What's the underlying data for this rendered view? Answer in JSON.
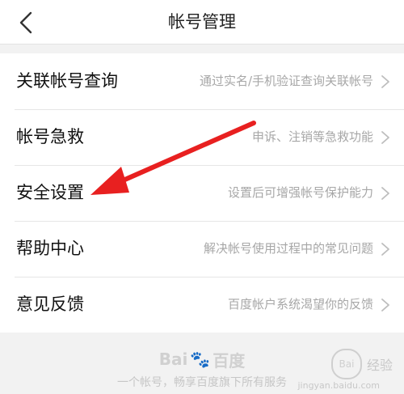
{
  "header": {
    "title": "帐号管理",
    "back_icon": "chevron-left-icon"
  },
  "rows": [
    {
      "label": "关联帐号查询",
      "description": "通过实名/手机验证查询关联帐号"
    },
    {
      "label": "帐号急救",
      "description": "申诉、注销等急救功能"
    },
    {
      "label": "安全设置",
      "description": "设置后可增强帐号保护能力"
    },
    {
      "label": "帮助中心",
      "description": "解决帐号使用过程中的常见问题"
    },
    {
      "label": "意见反馈",
      "description": "百度帐户系统渴望你的反馈"
    }
  ],
  "footer": {
    "logo_left": "Bai",
    "logo_paw": "🐾",
    "logo_right": "百度",
    "text": "一个帐号，畅享百度旗下所有服务"
  },
  "watermark": {
    "text": "经验",
    "sub": "jingyan.baidu.com"
  },
  "colors": {
    "annotation_arrow": "#e82020"
  }
}
